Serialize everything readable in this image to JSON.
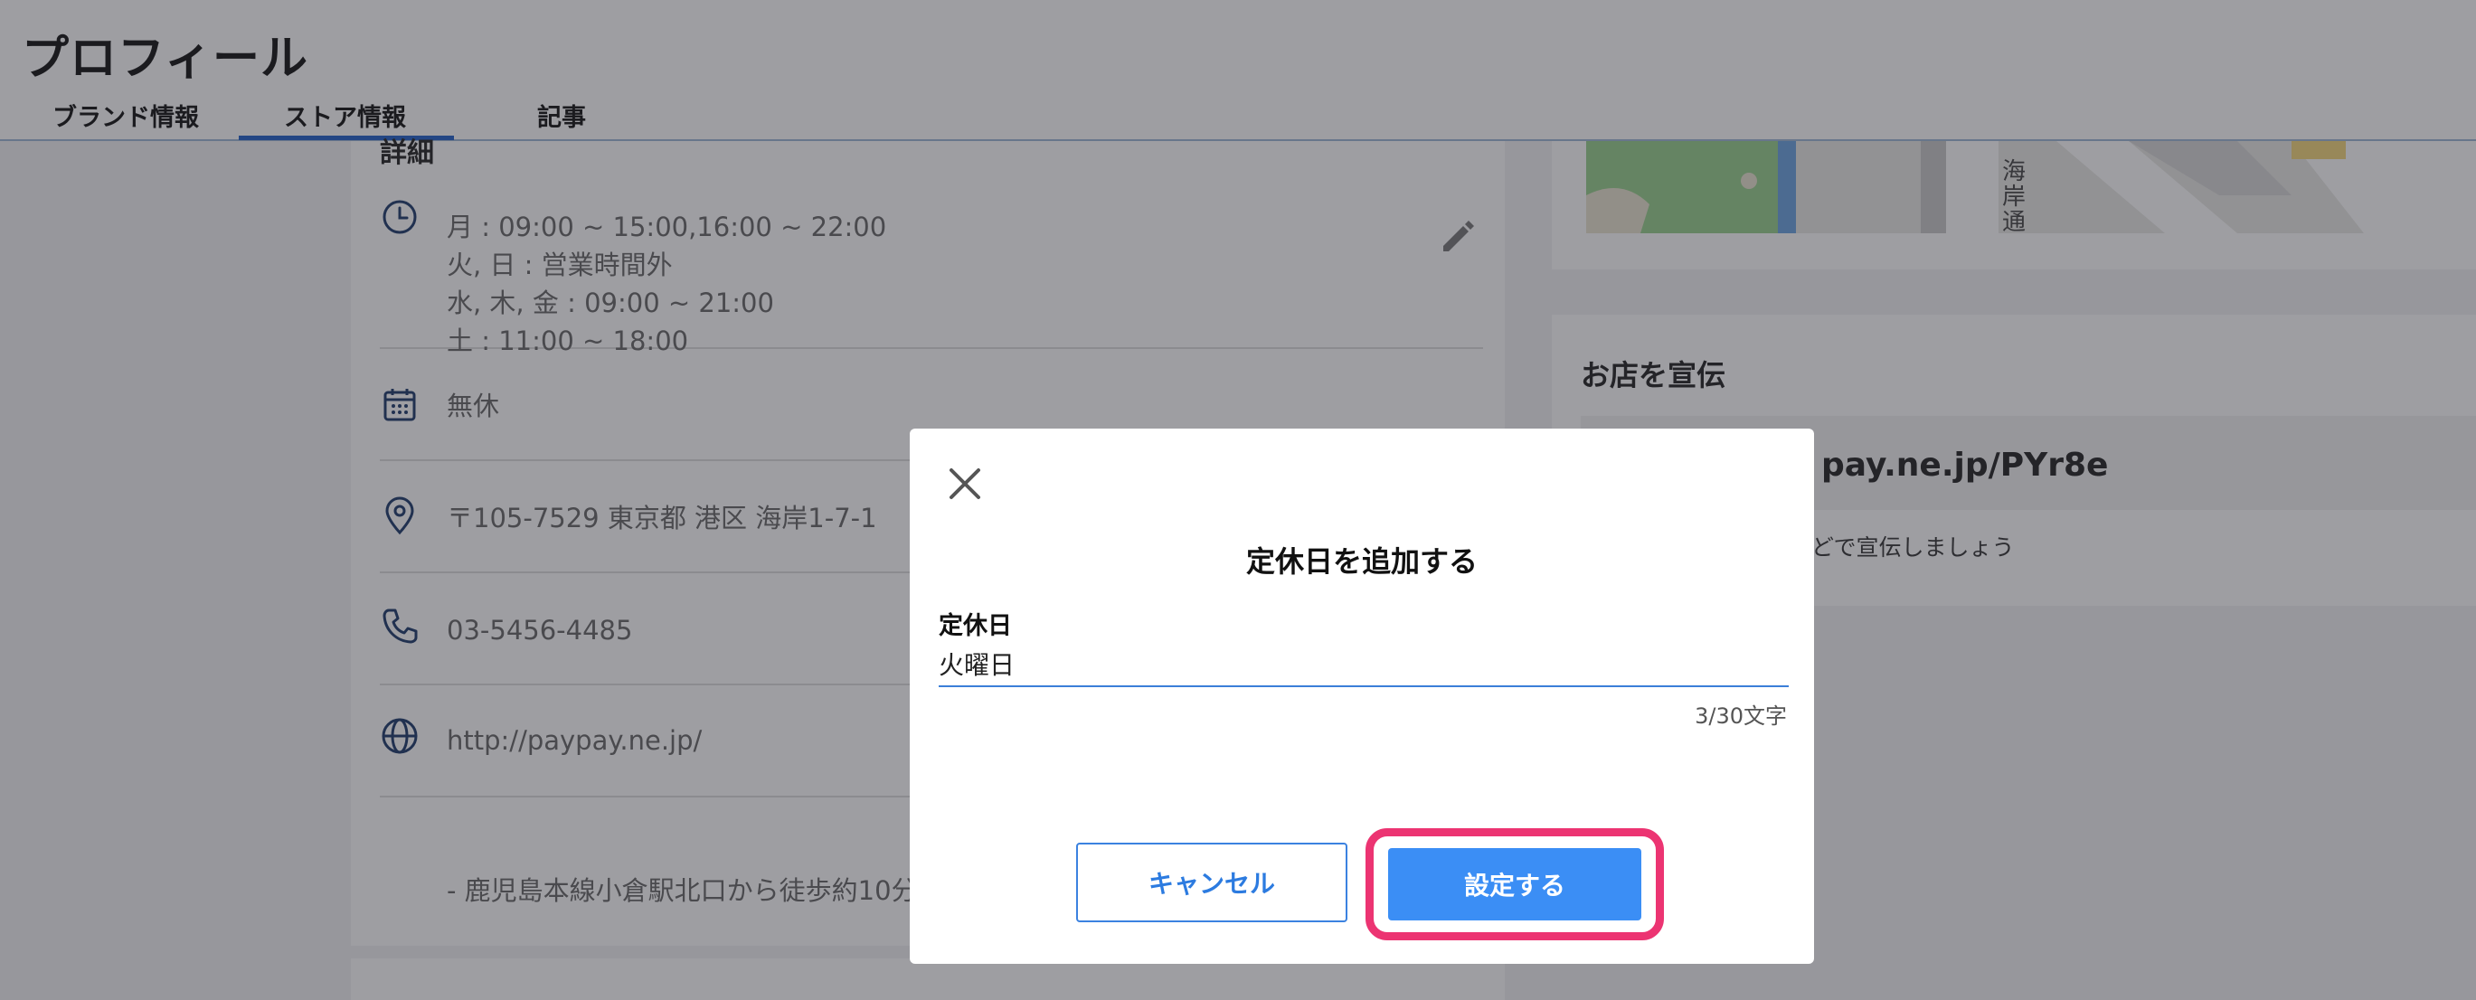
{
  "header": {
    "title": "プロフィール",
    "tabs": [
      {
        "label": "ブランド情報"
      },
      {
        "label": "ストア情報"
      },
      {
        "label": "記事"
      }
    ],
    "active_tab": "ストア情報"
  },
  "detail": {
    "heading": "詳細",
    "hours": [
      "月 : 09:00 ~ 15:00,16:00 ~ 22:00",
      "火, 日 : 営業時間外",
      "水, 木, 金 : 09:00 ~ 21:00",
      "土 : 11:00 ~ 18:00"
    ],
    "holiday": "無休",
    "address": "〒105-7529 東京都 港区 海岸1-7-1",
    "phone": "03-5456-4485",
    "website": "http://paypay.ne.jp/",
    "access": "- 鹿児島本線小倉駅北口から徒歩約10分"
  },
  "map": {
    "street_label": "海岸通"
  },
  "promo": {
    "title": "お店を宣伝",
    "url_visible": "pay.ne.jp/PYr8e",
    "note_visible": "などで宣伝しましょう"
  },
  "modal": {
    "title": "定休日を追加する",
    "field_label": "定休日",
    "field_value": "火曜日",
    "char_count": "3/30文字",
    "cancel_label": "キャンセル",
    "submit_label": "設定する"
  },
  "colors": {
    "accent": "#3b8ef5",
    "highlight": "#ec3472",
    "icon_navy": "#1c3a6b"
  }
}
